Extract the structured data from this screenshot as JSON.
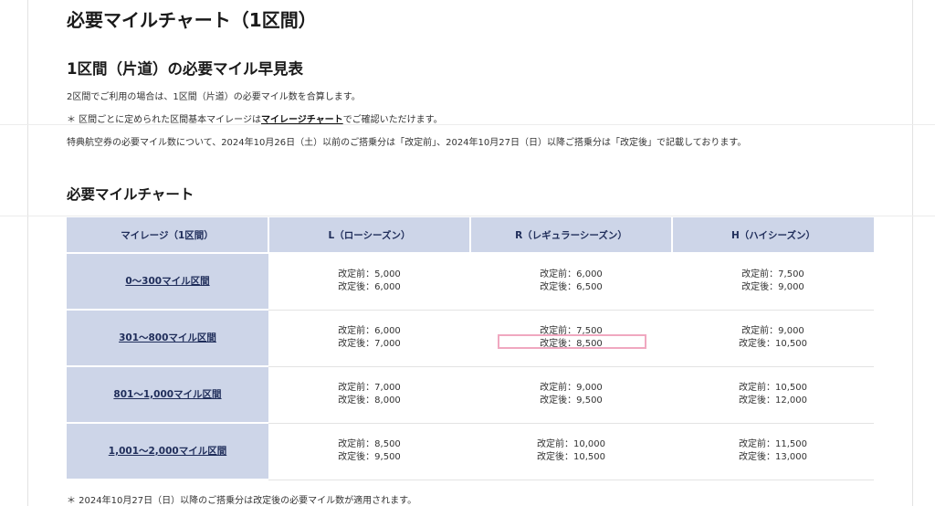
{
  "page_title": "必要マイルチャート（1区間）",
  "section_title": "1区間（片道）の必要マイル早見表",
  "intro": {
    "line1": "2区間でご利用の場合は、1区間（片道）の必要マイル数を合算します。",
    "line2_prefix": "＊ 区間ごとに定められた区間基本マイレージは",
    "line2_link": "マイレージチャート",
    "line2_suffix": "でご確認いただけます。",
    "line3": "特典航空券の必要マイル数について、2024年10月26日（土）以前のご搭乗分は「改定前」、2024年10月27日（日）以降ご搭乗分は「改定後」で記載しております。"
  },
  "chart_heading": "必要マイルチャート",
  "table": {
    "headers": [
      "マイレージ（1区間）",
      "L（ローシーズン）",
      "R（レギュラーシーズン）",
      "H（ハイシーズン）"
    ],
    "rows": [
      {
        "range": "0〜300マイル区間",
        "cells": [
          {
            "before": "改定前：5,000",
            "after": "改定後：6,000"
          },
          {
            "before": "改定前：6,000",
            "after": "改定後：6,500"
          },
          {
            "before": "改定前：7,500",
            "after": "改定後：9,000"
          }
        ]
      },
      {
        "range": "301〜800マイル区間",
        "cells": [
          {
            "before": "改定前：6,000",
            "after": "改定後：7,000"
          },
          {
            "before": "改定前：7,500",
            "after": "改定後：8,500"
          },
          {
            "before": "改定前：9,000",
            "after": "改定後：10,500"
          }
        ]
      },
      {
        "range": "801〜1,000マイル区間",
        "cells": [
          {
            "before": "改定前：7,000",
            "after": "改定後：8,000"
          },
          {
            "before": "改定前：9,000",
            "after": "改定後：9,500"
          },
          {
            "before": "改定前：10,500",
            "after": "改定後：12,000"
          }
        ]
      },
      {
        "range": "1,001〜2,000マイル区間",
        "cells": [
          {
            "before": "改定前：8,500",
            "after": "改定後：9,500"
          },
          {
            "before": "改定前：10,000",
            "after": "改定後：10,500"
          },
          {
            "before": "改定前：11,500",
            "after": "改定後：13,000"
          }
        ]
      }
    ]
  },
  "footnote": "＊ 2024年10月27日（日）以降のご搭乗分は改定後の必要マイル数が適用されます。",
  "colors": {
    "header_bg": "#cdd5e8",
    "header_text": "#1f2d5a",
    "highlight_border": "#f0a8c0"
  }
}
